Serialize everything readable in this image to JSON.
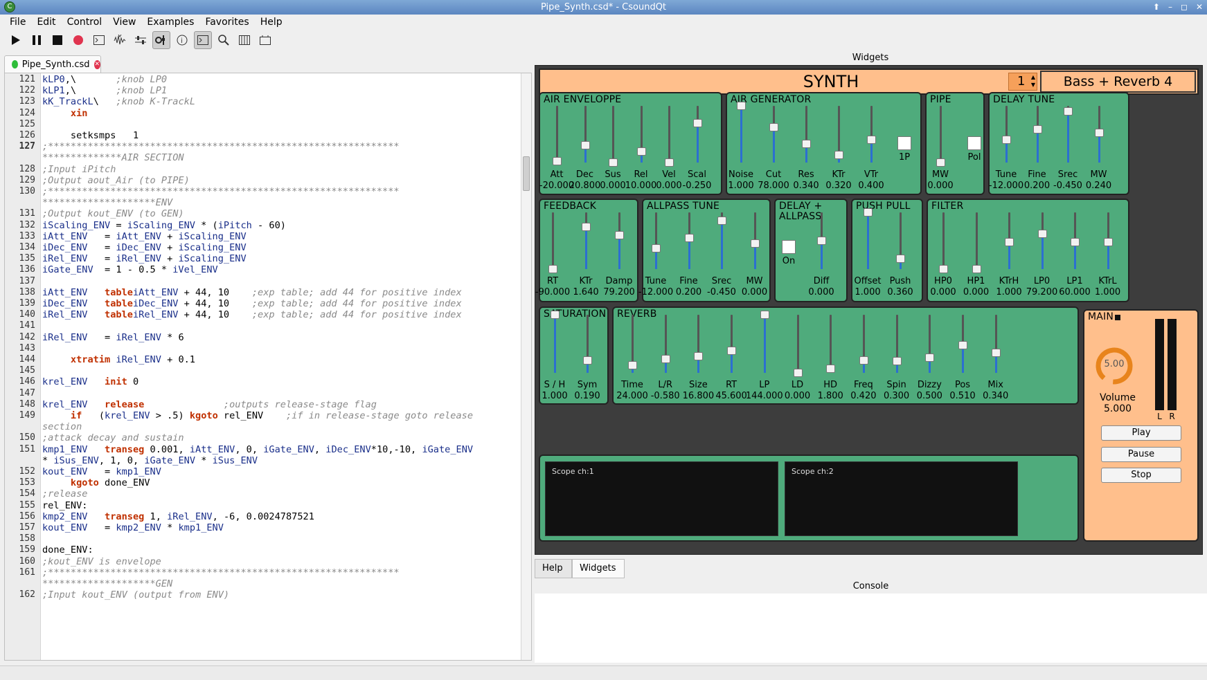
{
  "window": {
    "title": "Pipe_Synth.csd* - CsoundQt"
  },
  "menu": [
    "File",
    "Edit",
    "Control",
    "View",
    "Examples",
    "Favorites",
    "Help"
  ],
  "toolbar": {
    "icons": [
      "play-icon",
      "pause-icon",
      "stop-icon",
      "record-icon",
      "run-terminal-icon",
      "render-icon",
      "configure-icon",
      "widgets-toggle-icon",
      "inspector-icon",
      "console-icon",
      "search-icon",
      "virtual-keyboard-icon",
      "live-events-icon"
    ]
  },
  "editor": {
    "tab_label": "Pipe_Synth.csd",
    "lines": [
      {
        "n": "121",
        "segs": [
          [
            "v",
            "kLP0"
          ],
          [
            "s",
            ",\\       "
          ],
          [
            "c",
            ";knob LP0"
          ]
        ]
      },
      {
        "n": "122",
        "segs": [
          [
            "v",
            "kLP1"
          ],
          [
            "s",
            ",\\       "
          ],
          [
            "c",
            ";knob LP1"
          ]
        ]
      },
      {
        "n": "123",
        "segs": [
          [
            "v",
            "kK_TrackL"
          ],
          [
            "s",
            "\\   "
          ],
          [
            "c",
            ";knob K-TrackL"
          ]
        ]
      },
      {
        "n": "124",
        "segs": [
          [
            "s",
            "     "
          ],
          [
            "k",
            "xin"
          ]
        ]
      },
      {
        "n": "125",
        "segs": []
      },
      {
        "n": "126",
        "segs": [
          [
            "s",
            "     setksmps   1"
          ]
        ]
      },
      {
        "n": "127",
        "segs": [
          [
            "c",
            ";**************************************************************"
          ]
        ]
      },
      {
        "n": "",
        "segs": [
          [
            "c",
            "**************AIR SECTION"
          ]
        ]
      },
      {
        "n": "128",
        "segs": [
          [
            "c",
            ";Input iPitch"
          ]
        ]
      },
      {
        "n": "129",
        "segs": [
          [
            "c",
            ";Output aout_Air (to PIPE)"
          ]
        ]
      },
      {
        "n": "130",
        "segs": [
          [
            "c",
            ";**************************************************************"
          ]
        ]
      },
      {
        "n": "",
        "segs": [
          [
            "c",
            "********************ENV"
          ]
        ]
      },
      {
        "n": "131",
        "segs": [
          [
            "c",
            ";Output kout_ENV (to GEN)"
          ]
        ]
      },
      {
        "n": "132",
        "segs": [
          [
            "v",
            "iScaling_ENV"
          ],
          [
            "s",
            " = "
          ],
          [
            "v",
            "iScaling_ENV"
          ],
          [
            "s",
            " * ("
          ],
          [
            "v",
            "iPitch"
          ],
          [
            "s",
            " - 60)"
          ]
        ]
      },
      {
        "n": "133",
        "segs": [
          [
            "v",
            "iAtt_ENV"
          ],
          [
            "s",
            "   = "
          ],
          [
            "v",
            "iAtt_ENV"
          ],
          [
            "s",
            " + "
          ],
          [
            "v",
            "iScaling_ENV"
          ]
        ]
      },
      {
        "n": "134",
        "segs": [
          [
            "v",
            "iDec_ENV"
          ],
          [
            "s",
            "   = "
          ],
          [
            "v",
            "iDec_ENV"
          ],
          [
            "s",
            " + "
          ],
          [
            "v",
            "iScaling_ENV"
          ]
        ]
      },
      {
        "n": "135",
        "segs": [
          [
            "v",
            "iRel_ENV"
          ],
          [
            "s",
            "   = "
          ],
          [
            "v",
            "iRel_ENV"
          ],
          [
            "s",
            " + "
          ],
          [
            "v",
            "iScaling_ENV"
          ]
        ]
      },
      {
        "n": "136",
        "segs": [
          [
            "v",
            "iGate_ENV"
          ],
          [
            "s",
            "  = 1 - 0.5 * "
          ],
          [
            "v",
            "iVel_ENV"
          ]
        ]
      },
      {
        "n": "137",
        "segs": []
      },
      {
        "n": "138",
        "segs": [
          [
            "v",
            "iAtt_ENV"
          ],
          [
            "s",
            "   "
          ],
          [
            "k",
            "table"
          ],
          [
            "v",
            "iAtt_ENV"
          ],
          [
            "s",
            " + 44, 10    "
          ],
          [
            "c",
            ";exp table; add 44 for positive index"
          ]
        ]
      },
      {
        "n": "139",
        "segs": [
          [
            "v",
            "iDec_ENV"
          ],
          [
            "s",
            "   "
          ],
          [
            "k",
            "table"
          ],
          [
            "v",
            "iDec_ENV"
          ],
          [
            "s",
            " + 44, 10    "
          ],
          [
            "c",
            ";exp table; add 44 for positive index"
          ]
        ]
      },
      {
        "n": "140",
        "segs": [
          [
            "v",
            "iRel_ENV"
          ],
          [
            "s",
            "   "
          ],
          [
            "k",
            "table"
          ],
          [
            "v",
            "iRel_ENV"
          ],
          [
            "s",
            " + 44, 10    "
          ],
          [
            "c",
            ";exp table; add 44 for positive index"
          ]
        ]
      },
      {
        "n": "141",
        "segs": []
      },
      {
        "n": "142",
        "segs": [
          [
            "v",
            "iRel_ENV"
          ],
          [
            "s",
            "   = "
          ],
          [
            "v",
            "iRel_ENV"
          ],
          [
            "s",
            " * 6"
          ]
        ]
      },
      {
        "n": "143",
        "segs": []
      },
      {
        "n": "144",
        "segs": [
          [
            "s",
            "     "
          ],
          [
            "k",
            "xtratim"
          ],
          [
            "s",
            " "
          ],
          [
            "v",
            "iRel_ENV"
          ],
          [
            "s",
            " + 0.1"
          ]
        ]
      },
      {
        "n": "145",
        "segs": []
      },
      {
        "n": "146",
        "segs": [
          [
            "v",
            "krel_ENV"
          ],
          [
            "s",
            "   "
          ],
          [
            "k",
            "init"
          ],
          [
            "s",
            " 0"
          ]
        ]
      },
      {
        "n": "147",
        "segs": []
      },
      {
        "n": "148",
        "segs": [
          [
            "v",
            "krel_ENV"
          ],
          [
            "s",
            "   "
          ],
          [
            "k",
            "release"
          ],
          [
            "s",
            "              "
          ],
          [
            "c",
            ";outputs release-stage flag"
          ]
        ]
      },
      {
        "n": "149",
        "segs": [
          [
            "s",
            "     "
          ],
          [
            "k",
            "if"
          ],
          [
            "s",
            "   ("
          ],
          [
            "v",
            "krel_ENV"
          ],
          [
            "s",
            " > .5) "
          ],
          [
            "k",
            "kgoto"
          ],
          [
            "s",
            " rel_ENV    "
          ],
          [
            "c",
            ";if in release-stage goto release"
          ]
        ]
      },
      {
        "n": "",
        "segs": [
          [
            "c",
            "section"
          ]
        ]
      },
      {
        "n": "150",
        "segs": [
          [
            "c",
            ";attack decay and sustain"
          ]
        ]
      },
      {
        "n": "151",
        "segs": [
          [
            "v",
            "kmp1_ENV"
          ],
          [
            "s",
            "   "
          ],
          [
            "k",
            "transeg"
          ],
          [
            "s",
            " 0.001, "
          ],
          [
            "v",
            "iAtt_ENV"
          ],
          [
            "s",
            ", 0, "
          ],
          [
            "v",
            "iGate_ENV"
          ],
          [
            "s",
            ", "
          ],
          [
            "v",
            "iDec_ENV"
          ],
          [
            "s",
            "*10,-10, "
          ],
          [
            "v",
            "iGate_ENV"
          ]
        ]
      },
      {
        "n": "",
        "segs": [
          [
            "s",
            "* "
          ],
          [
            "v",
            "iSus_ENV"
          ],
          [
            "s",
            ", 1, 0, "
          ],
          [
            "v",
            "iGate_ENV"
          ],
          [
            "s",
            " * "
          ],
          [
            "v",
            "iSus_ENV"
          ]
        ]
      },
      {
        "n": "152",
        "segs": [
          [
            "v",
            "kout_ENV"
          ],
          [
            "s",
            "   = "
          ],
          [
            "v",
            "kmp1_ENV"
          ]
        ]
      },
      {
        "n": "153",
        "segs": [
          [
            "s",
            "     "
          ],
          [
            "k",
            "kgoto"
          ],
          [
            "s",
            " done_ENV"
          ]
        ]
      },
      {
        "n": "154",
        "segs": [
          [
            "c",
            ";release"
          ]
        ]
      },
      {
        "n": "155",
        "segs": [
          [
            "s",
            "rel_ENV:"
          ]
        ]
      },
      {
        "n": "156",
        "segs": [
          [
            "v",
            "kmp2_ENV"
          ],
          [
            "s",
            "   "
          ],
          [
            "k",
            "transeg"
          ],
          [
            "s",
            " 1, "
          ],
          [
            "v",
            "iRel_ENV"
          ],
          [
            "s",
            ", -6, 0.0024787521"
          ]
        ]
      },
      {
        "n": "157",
        "segs": [
          [
            "v",
            "kout_ENV"
          ],
          [
            "s",
            "   = "
          ],
          [
            "v",
            "kmp2_ENV"
          ],
          [
            "s",
            " * "
          ],
          [
            "v",
            "kmp1_ENV"
          ]
        ]
      },
      {
        "n": "158",
        "segs": []
      },
      {
        "n": "159",
        "segs": [
          [
            "s",
            "done_ENV:"
          ]
        ]
      },
      {
        "n": "160",
        "segs": [
          [
            "c",
            ";kout_ENV is envelope"
          ]
        ]
      },
      {
        "n": "161",
        "segs": [
          [
            "c",
            ";**************************************************************"
          ]
        ]
      },
      {
        "n": "",
        "segs": [
          [
            "c",
            "********************GEN"
          ]
        ]
      },
      {
        "n": "162",
        "segs": [
          [
            "c",
            ";Input kout_ENV (output from ENV)"
          ]
        ]
      }
    ]
  },
  "widgets": {
    "title": "Widgets",
    "synth_label": "SYNTH",
    "preset_number": "1",
    "preset_name": "Bass + Reverb 4",
    "sections": [
      {
        "title": "AIR ENVELOPPE",
        "sliders": [
          {
            "label": "Att",
            "value": "-20.000",
            "pos": 0.03
          },
          {
            "label": "Dec",
            "value": "20.800",
            "pos": 0.3
          },
          {
            "label": "Sus",
            "value": "0.000",
            "pos": 0.0
          },
          {
            "label": "Rel",
            "value": "10.000",
            "pos": 0.2
          },
          {
            "label": "Vel",
            "value": "0.000",
            "pos": 0.0
          },
          {
            "label": "Scal",
            "value": "-0.250",
            "pos": 0.7
          }
        ]
      },
      {
        "title": "AIR GENERATOR",
        "sliders": [
          {
            "label": "Noise",
            "value": "1.000",
            "pos": 1.0
          },
          {
            "label": "Cut",
            "value": "78.000",
            "pos": 0.62
          },
          {
            "label": "Res",
            "value": "0.340",
            "pos": 0.33
          },
          {
            "label": "KTr",
            "value": "0.320",
            "pos": 0.13
          },
          {
            "label": "VTr",
            "value": "0.400",
            "pos": 0.4
          }
        ],
        "checkbox": "1P"
      },
      {
        "title": "PIPE",
        "sliders": [
          {
            "label": "MW",
            "value": "0.000",
            "pos": 0.0
          }
        ],
        "checkbox": "Pol"
      },
      {
        "title": "DELAY TUNE",
        "sliders": [
          {
            "label": "Tune",
            "value": "-12.000",
            "pos": 0.4
          },
          {
            "label": "Fine",
            "value": "0.200",
            "pos": 0.58
          },
          {
            "label": "Srec",
            "value": "-0.450",
            "pos": 0.9
          },
          {
            "label": "MW",
            "value": "0.240",
            "pos": 0.52
          }
        ]
      },
      {
        "title": "FEEDBACK",
        "sliders": [
          {
            "label": "RT",
            "value": "-90.000",
            "pos": 0.0
          },
          {
            "label": "KTr",
            "value": "1.640",
            "pos": 0.75
          },
          {
            "label": "Damp",
            "value": "79.200",
            "pos": 0.6
          }
        ]
      },
      {
        "title": "ALLPASS TUNE",
        "sliders": [
          {
            "label": "Tune",
            "value": "-12.000",
            "pos": 0.37
          },
          {
            "label": "Fine",
            "value": "0.200",
            "pos": 0.55
          },
          {
            "label": "Srec",
            "value": "-0.450",
            "pos": 0.85
          },
          {
            "label": "MW",
            "value": "0.000",
            "pos": 0.45
          }
        ]
      },
      {
        "title": "DELAY + ALLPASS",
        "sliders": [
          {
            "label": "Diff",
            "value": "0.000",
            "pos": 0.5
          }
        ],
        "checkbox": "On"
      },
      {
        "title": "PUSH PULL",
        "sliders": [
          {
            "label": "Offset",
            "value": "1.000",
            "pos": 1.0
          },
          {
            "label": "Push",
            "value": "0.360",
            "pos": 0.18
          }
        ]
      },
      {
        "title": "FILTER",
        "sliders": [
          {
            "label": "HP0",
            "value": "0.000",
            "pos": 0.0
          },
          {
            "label": "HP1",
            "value": "0.000",
            "pos": 0.0
          },
          {
            "label": "KTrH",
            "value": "1.000",
            "pos": 0.48
          },
          {
            "label": "LP0",
            "value": "79.200",
            "pos": 0.62
          },
          {
            "label": "LP1",
            "value": "60.000",
            "pos": 0.48
          },
          {
            "label": "KTrL",
            "value": "1.000",
            "pos": 0.48
          }
        ]
      },
      {
        "title": "SATURATION",
        "sliders": [
          {
            "label": "S / H",
            "value": "1.000",
            "pos": 1.0
          },
          {
            "label": "Sym",
            "value": "0.190",
            "pos": 0.22
          }
        ]
      },
      {
        "title": "REVERB",
        "sliders": [
          {
            "label": "Time",
            "value": "24.000",
            "pos": 0.13
          },
          {
            "label": "L/R",
            "value": "-0.580",
            "pos": 0.24
          },
          {
            "label": "Size",
            "value": "16.800",
            "pos": 0.28
          },
          {
            "label": "RT",
            "value": "45.600",
            "pos": 0.38
          },
          {
            "label": "LP",
            "value": "144.000",
            "pos": 1.0
          },
          {
            "label": "LD",
            "value": "0.000",
            "pos": 0.0
          },
          {
            "label": "HD",
            "value": "1.800",
            "pos": 0.07
          },
          {
            "label": "Freq",
            "value": "0.420",
            "pos": 0.22
          },
          {
            "label": "Spin",
            "value": "0.300",
            "pos": 0.2
          },
          {
            "label": "Dizzy",
            "value": "0.500",
            "pos": 0.26
          },
          {
            "label": "Pos",
            "value": "0.510",
            "pos": 0.48
          },
          {
            "label": "Mix",
            "value": "0.340",
            "pos": 0.34
          }
        ]
      }
    ],
    "scopes": [
      "Scope ch:1",
      "Scope ch:2"
    ],
    "main": {
      "title": "MAIN",
      "knob_value": "5.00",
      "volume_label": "Volume",
      "volume_value": "5.000",
      "meter_left": "L",
      "meter_right": "R",
      "buttons": [
        "Play",
        "Pause",
        "Stop"
      ]
    }
  },
  "bottom_tabs": [
    "Help",
    "Widgets"
  ],
  "console_title": "Console",
  "colors": {
    "panel_green": "#4fab7c",
    "synth_orange": "#ffbf8c",
    "knob_orange": "#f08a1c",
    "keyword": "#c03000",
    "variable": "#1a2f8a",
    "comment": "#8a8a8a"
  }
}
